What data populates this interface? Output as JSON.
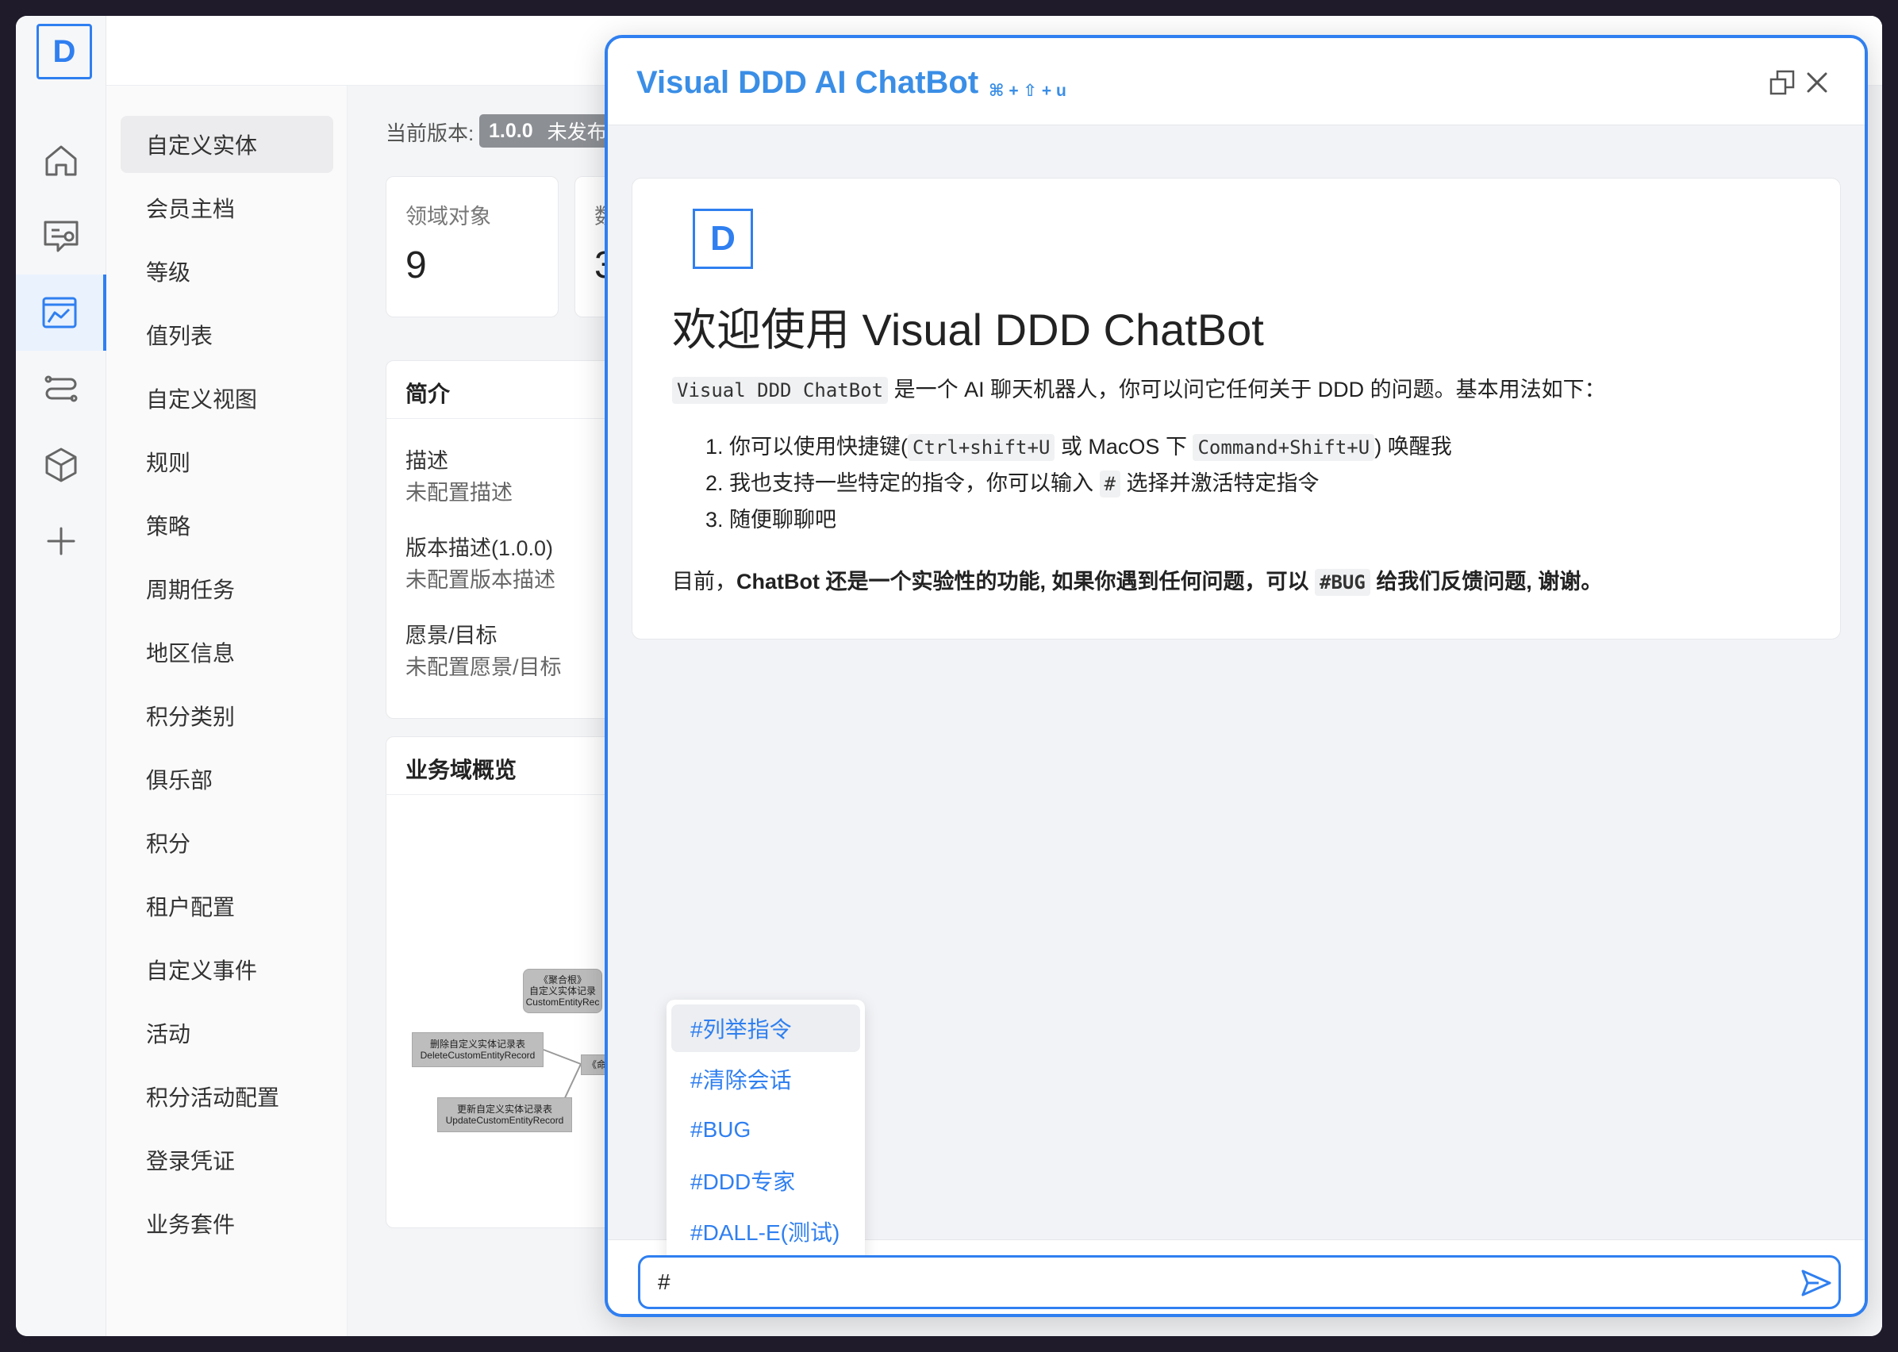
{
  "sidebar": {
    "logo_text": "D",
    "items": [
      {
        "icon": "home-icon"
      },
      {
        "icon": "chat-icon"
      },
      {
        "icon": "chart-board-icon",
        "active": true
      },
      {
        "icon": "flow-icon"
      },
      {
        "icon": "cube-icon"
      },
      {
        "icon": "plus-icon"
      }
    ]
  },
  "menu": {
    "items": [
      "自定义实体",
      "会员主档",
      "等级",
      "值列表",
      "自定义视图",
      "规则",
      "策略",
      "周期任务",
      "地区信息",
      "积分类别",
      "俱乐部",
      "积分",
      "租户配置",
      "自定义事件",
      "活动",
      "积分活动配置",
      "登录凭证",
      "业务套件"
    ],
    "active_index": 0
  },
  "main": {
    "version_label": "当前版本:",
    "version_number": "1.0.0",
    "version_status": "未发布",
    "stat_label": "领域对象",
    "stat_value": "9",
    "stat2_label": "数",
    "stat2_value": "3",
    "intro": {
      "title": "简介",
      "fields": [
        {
          "key": "描述",
          "value": "未配置描述"
        },
        {
          "key": "版本描述(1.0.0)",
          "value": "未配置版本描述"
        },
        {
          "key": "愿景/目标",
          "value": "未配置愿景/目标"
        }
      ]
    },
    "overview": {
      "title": "业务域概览",
      "nodes": [
        {
          "line1": "《聚合根》",
          "line2": "自定义实体记录",
          "line3": "CustomEntityRec"
        },
        {
          "line1": "删除自定义实体记录表",
          "line2": "DeleteCustomEntityRecord"
        },
        {
          "line1": "更新自定义实体记录表",
          "line2": "UpdateCustomEntityRecord"
        },
        {
          "line1": "《命"
        }
      ]
    }
  },
  "chat": {
    "title": "Visual DDD AI ChatBot",
    "shortcut": "⌘ + ⇧ + u",
    "welcome": {
      "heading": "欢迎使用 Visual DDD ChatBot",
      "intro_code": "Visual DDD ChatBot",
      "intro_text": "是一个 AI 聊天机器人，你可以问它任何关于 DDD 的问题。基本用法如下：",
      "li1_a": "1. 你可以使用快捷键(",
      "li1_code1": "Ctrl+shift+U",
      "li1_b": "或 MacOS 下",
      "li1_code2": "Command+Shift+U",
      "li1_c": ") 唤醒我",
      "li2_a": "2. 我也支持一些特定的指令，你可以输入",
      "li2_code": "#",
      "li2_b": "选择并激活特定指令",
      "li3": "3. 随便聊聊吧",
      "note_a": "目前，",
      "note_b": "ChatBot 还是一个实验性的功能, 如果你遇到任何问题，可以",
      "note_code": "#BUG",
      "note_c": "给我们反馈问题, 谢谢。"
    },
    "commands": [
      "#列举指令",
      "#清除会话",
      "#BUG",
      "#DDD专家",
      "#DALL-E(测试)"
    ],
    "input_value": "#"
  },
  "colors": {
    "accent": "#2f7ff0",
    "title": "#3a8ee6"
  }
}
